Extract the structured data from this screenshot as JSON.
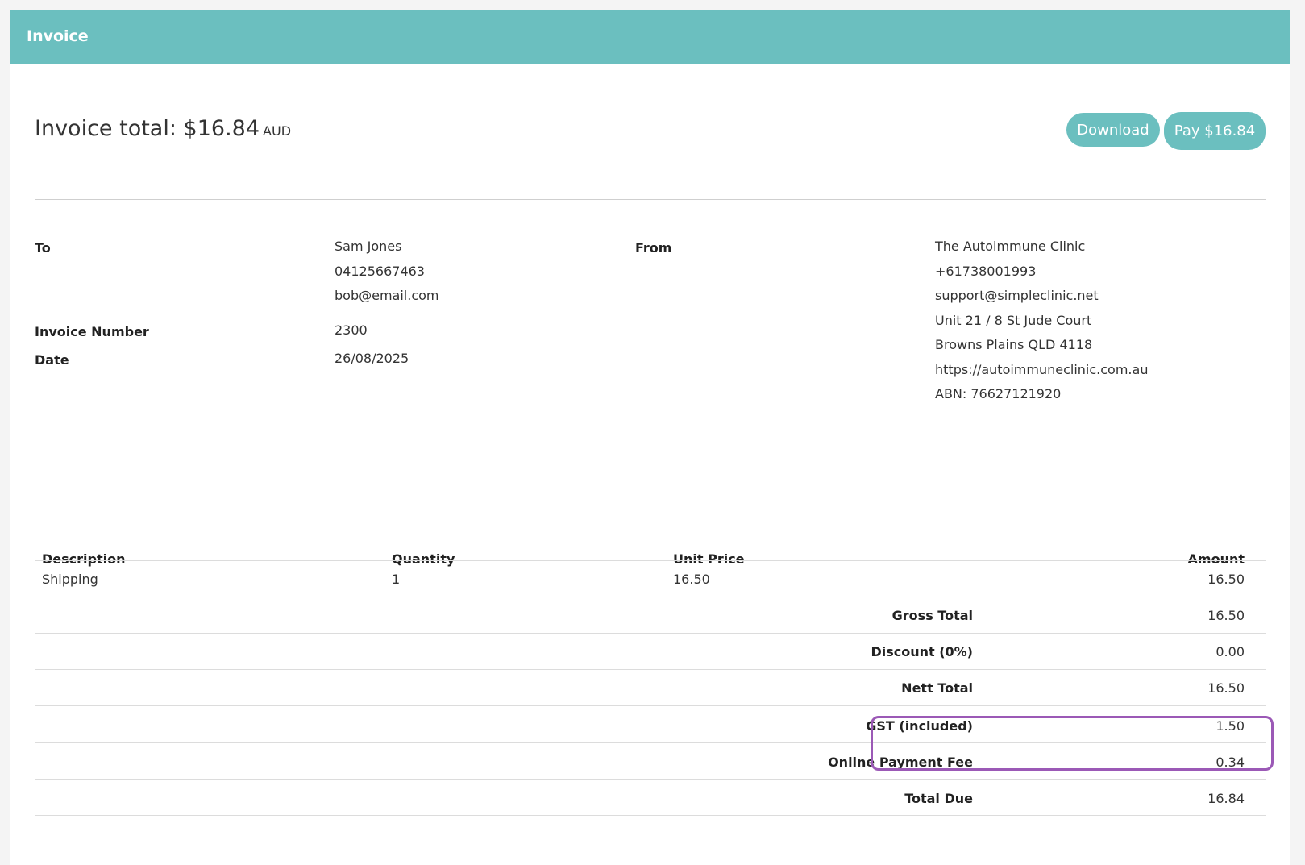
{
  "header": {
    "title": "Invoice"
  },
  "summary": {
    "total_label": "Invoice total:",
    "total_amount": "$16.84",
    "currency": "AUD",
    "download_label": "Download",
    "pay_label": "Pay $16.84"
  },
  "to": {
    "label": "To",
    "name": "Sam Jones",
    "phone": "04125667463",
    "email": "bob@email.com"
  },
  "invoice_number": {
    "label": "Invoice Number",
    "value": "2300"
  },
  "date": {
    "label": "Date",
    "value": "26/08/2025"
  },
  "from": {
    "label": "From",
    "name": "The Autoimmune Clinic",
    "phone": "+61738001993",
    "email": "support@simpleclinic.net",
    "address1": "Unit 21 / 8 St Jude Court",
    "address2": "Browns Plains QLD 4118",
    "website": "https://autoimmuneclinic.com.au",
    "abn": "ABN: 76627121920"
  },
  "table": {
    "headers": {
      "description": "Description",
      "quantity": "Quantity",
      "unit_price": "Unit Price",
      "amount": "Amount"
    },
    "items": [
      {
        "description": "Shipping",
        "quantity": "1",
        "unit_price": "16.50",
        "amount": "16.50"
      }
    ],
    "totals": [
      {
        "label": "Gross Total",
        "value": "16.50"
      },
      {
        "label": "Discount (0%)",
        "value": "0.00"
      },
      {
        "label": "Nett Total",
        "value": "16.50"
      },
      {
        "label": "GST (included)",
        "value": "1.50"
      },
      {
        "label": "Online Payment Fee",
        "value": "0.34"
      },
      {
        "label": "Total Due",
        "value": "16.84"
      }
    ]
  },
  "colors": {
    "accent": "#6bbfbf",
    "highlight": "#9b59b6"
  }
}
